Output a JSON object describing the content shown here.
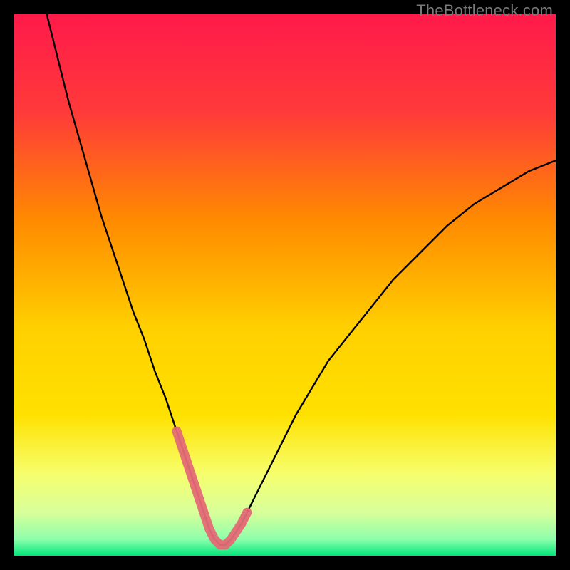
{
  "watermark": {
    "text": "TheBottleneck.com"
  },
  "colors": {
    "frame_bg": "#000000",
    "gradient_top": "#ff1a4a",
    "gradient_mid1": "#ff8a00",
    "gradient_mid2": "#ffe100",
    "gradient_mid3": "#f6ff6e",
    "gradient_low": "#d8ff9a",
    "gradient_bottom": "#00e67a",
    "curve": "#000000",
    "highlight": "#e46a76"
  },
  "chart_data": {
    "type": "line",
    "title": "",
    "xlabel": "",
    "ylabel": "",
    "xlim": [
      0,
      100
    ],
    "ylim": [
      0,
      100
    ],
    "grid": false,
    "legend": false,
    "series": [
      {
        "name": "bottleneck-curve",
        "x": [
          6,
          8,
          10,
          12,
          14,
          16,
          18,
          20,
          22,
          24,
          26,
          28,
          30,
          32,
          33,
          34,
          35,
          36,
          37,
          38,
          39,
          40,
          42,
          44,
          46,
          48,
          50,
          52,
          55,
          58,
          62,
          66,
          70,
          75,
          80,
          85,
          90,
          95,
          100
        ],
        "y": [
          100,
          92,
          84,
          77,
          70,
          63,
          57,
          51,
          45,
          40,
          34,
          29,
          23,
          17,
          14,
          11,
          8,
          5,
          3,
          2,
          2,
          3,
          6,
          10,
          14,
          18,
          22,
          26,
          31,
          36,
          41,
          46,
          51,
          56,
          61,
          65,
          68,
          71,
          73
        ]
      }
    ],
    "highlight_segment": {
      "name": "valley-highlight",
      "x": [
        30,
        31,
        32,
        33,
        34,
        35,
        36,
        37,
        38,
        39,
        40,
        41,
        42,
        43
      ],
      "y": [
        23,
        20,
        17,
        14,
        11,
        8,
        5,
        3,
        2,
        2,
        3,
        4.5,
        6,
        8
      ]
    }
  }
}
